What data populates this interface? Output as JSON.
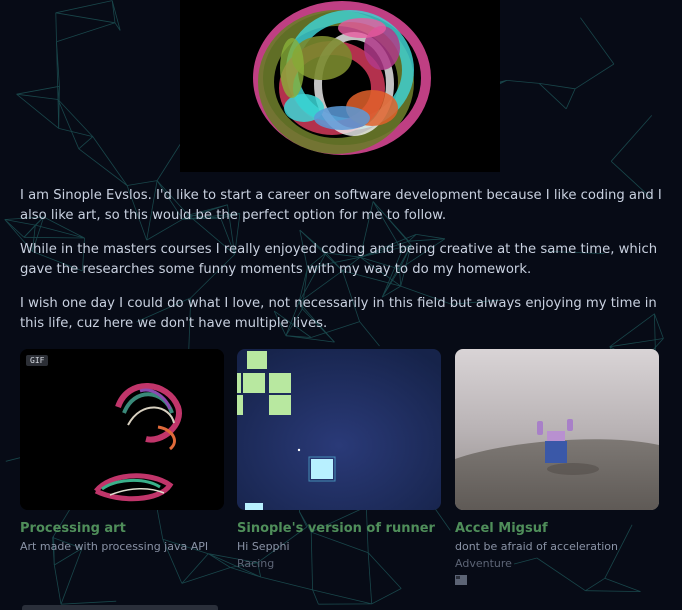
{
  "bio": {
    "paragraphs": [
      "I am Sinople Evslos. I'd like to start a career on software development because I like coding and I also like art, so this would be the perfect option for me to follow.",
      "While in the masters courses I really enjoyed coding and being creative at the same time, which gave the researches some funny moments with my way to do my homework.",
      "I wish one day I could do what I love, not necessarily in this field but always enjoying my time in this life, cuz here we don't have multiple lives."
    ]
  },
  "projects": [
    {
      "title": "Processing art",
      "description": "Art made with processing java API",
      "genre": "",
      "badge": "GIF"
    },
    {
      "title": "Sinople's version of runner",
      "description": "Hi Sepphi",
      "genre": "Racing"
    },
    {
      "title": "Accel Migsuf",
      "description": "dont be afraid of acceleration",
      "genre": "Adventure",
      "icon": "window-icon"
    }
  ],
  "colors": {
    "background": "#070b16",
    "accent_title": "#4f8e5a",
    "network_lines": "#1f5a5c"
  }
}
